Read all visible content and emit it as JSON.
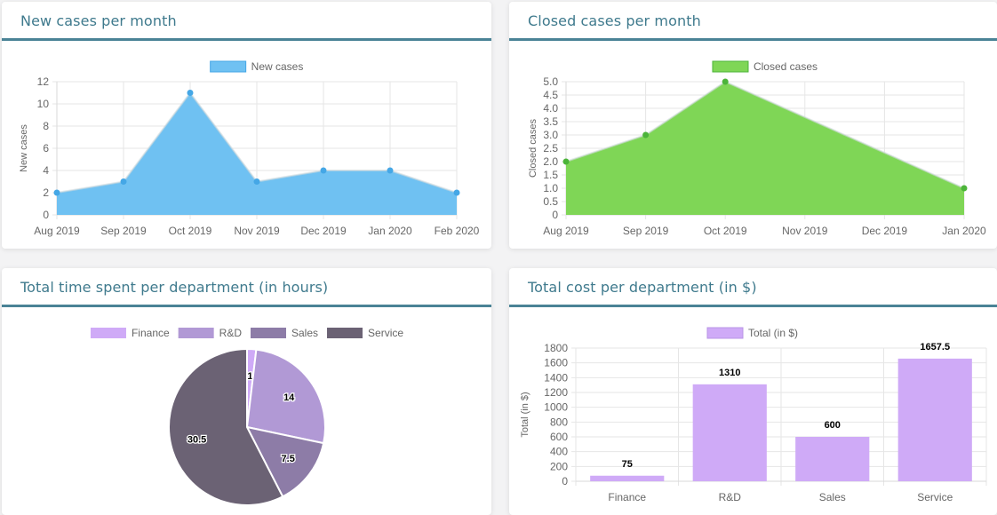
{
  "colors": {
    "header_rule": "#4a8396",
    "title": "#3f7a8d",
    "grid": "#e6e6e6",
    "text": "#666666"
  },
  "cards": {
    "new_cases": {
      "title": "New cases per month"
    },
    "closed_cases": {
      "title": "Closed cases per month"
    },
    "time_dept": {
      "title": "Total time spent per department (in hours)"
    },
    "cost_dept": {
      "title": "Total cost per department (in $)"
    }
  },
  "chart_data": [
    {
      "id": "new_cases",
      "type": "area",
      "categories": [
        "Aug 2019",
        "Sep 2019",
        "Oct 2019",
        "Nov 2019",
        "Dec 2019",
        "Jan 2020",
        "Feb 2020"
      ],
      "series": [
        {
          "name": "New cases",
          "values": [
            2,
            3,
            11,
            3,
            4,
            4,
            2
          ],
          "color": "#5ab8ef",
          "fill": "#6fc1f2",
          "point": "#45a7e6"
        }
      ],
      "ylabel": "New cases",
      "ylim": [
        0,
        12
      ],
      "yticks": [
        "0",
        "2",
        "4",
        "6",
        "8",
        "10",
        "12"
      ],
      "grid": true,
      "legend": "top-center"
    },
    {
      "id": "closed_cases",
      "type": "area",
      "categories": [
        "Aug 2019",
        "Sep 2019",
        "Oct 2019",
        "Nov 2019",
        "Dec 2019",
        "Jan 2020"
      ],
      "series": [
        {
          "name": "Closed cases",
          "values": [
            2,
            3,
            5,
            null,
            null,
            1
          ],
          "color": "#58c840",
          "fill": "#7fd656",
          "point": "#4cb43a"
        }
      ],
      "ylabel": "Closed cases",
      "ylim": [
        0,
        5
      ],
      "yticks": [
        "0",
        "0.5",
        "1.0",
        "1.5",
        "2.0",
        "2.5",
        "3.0",
        "3.5",
        "4.0",
        "4.5",
        "5.0"
      ],
      "grid": true,
      "legend": "top-center"
    },
    {
      "id": "time_dept",
      "type": "pie",
      "labels": [
        "Finance",
        "R&D",
        "Sales",
        "Service"
      ],
      "values": [
        1,
        14,
        7.5,
        30.5
      ],
      "data_labels": [
        "1",
        "14",
        "7.5",
        "30.5"
      ],
      "colors": [
        "#cfaaf7",
        "#b199d5",
        "#8d7ca7",
        "#6b6274"
      ],
      "legend": "top-center"
    },
    {
      "id": "cost_dept",
      "type": "bar",
      "categories": [
        "Finance",
        "R&D",
        "Sales",
        "Service"
      ],
      "series": [
        {
          "name": "Total (in $)",
          "values": [
            75,
            1310,
            600,
            1657.5
          ],
          "color": "#cfaaf7"
        }
      ],
      "data_labels": [
        "75",
        "1310",
        "600",
        "1657.5"
      ],
      "ylabel": "Total (in $)",
      "ylim": [
        0,
        1800
      ],
      "yticks": [
        "0",
        "200",
        "400",
        "600",
        "800",
        "1000",
        "1200",
        "1400",
        "1600",
        "1800"
      ],
      "grid": true,
      "legend": "top-center"
    }
  ]
}
